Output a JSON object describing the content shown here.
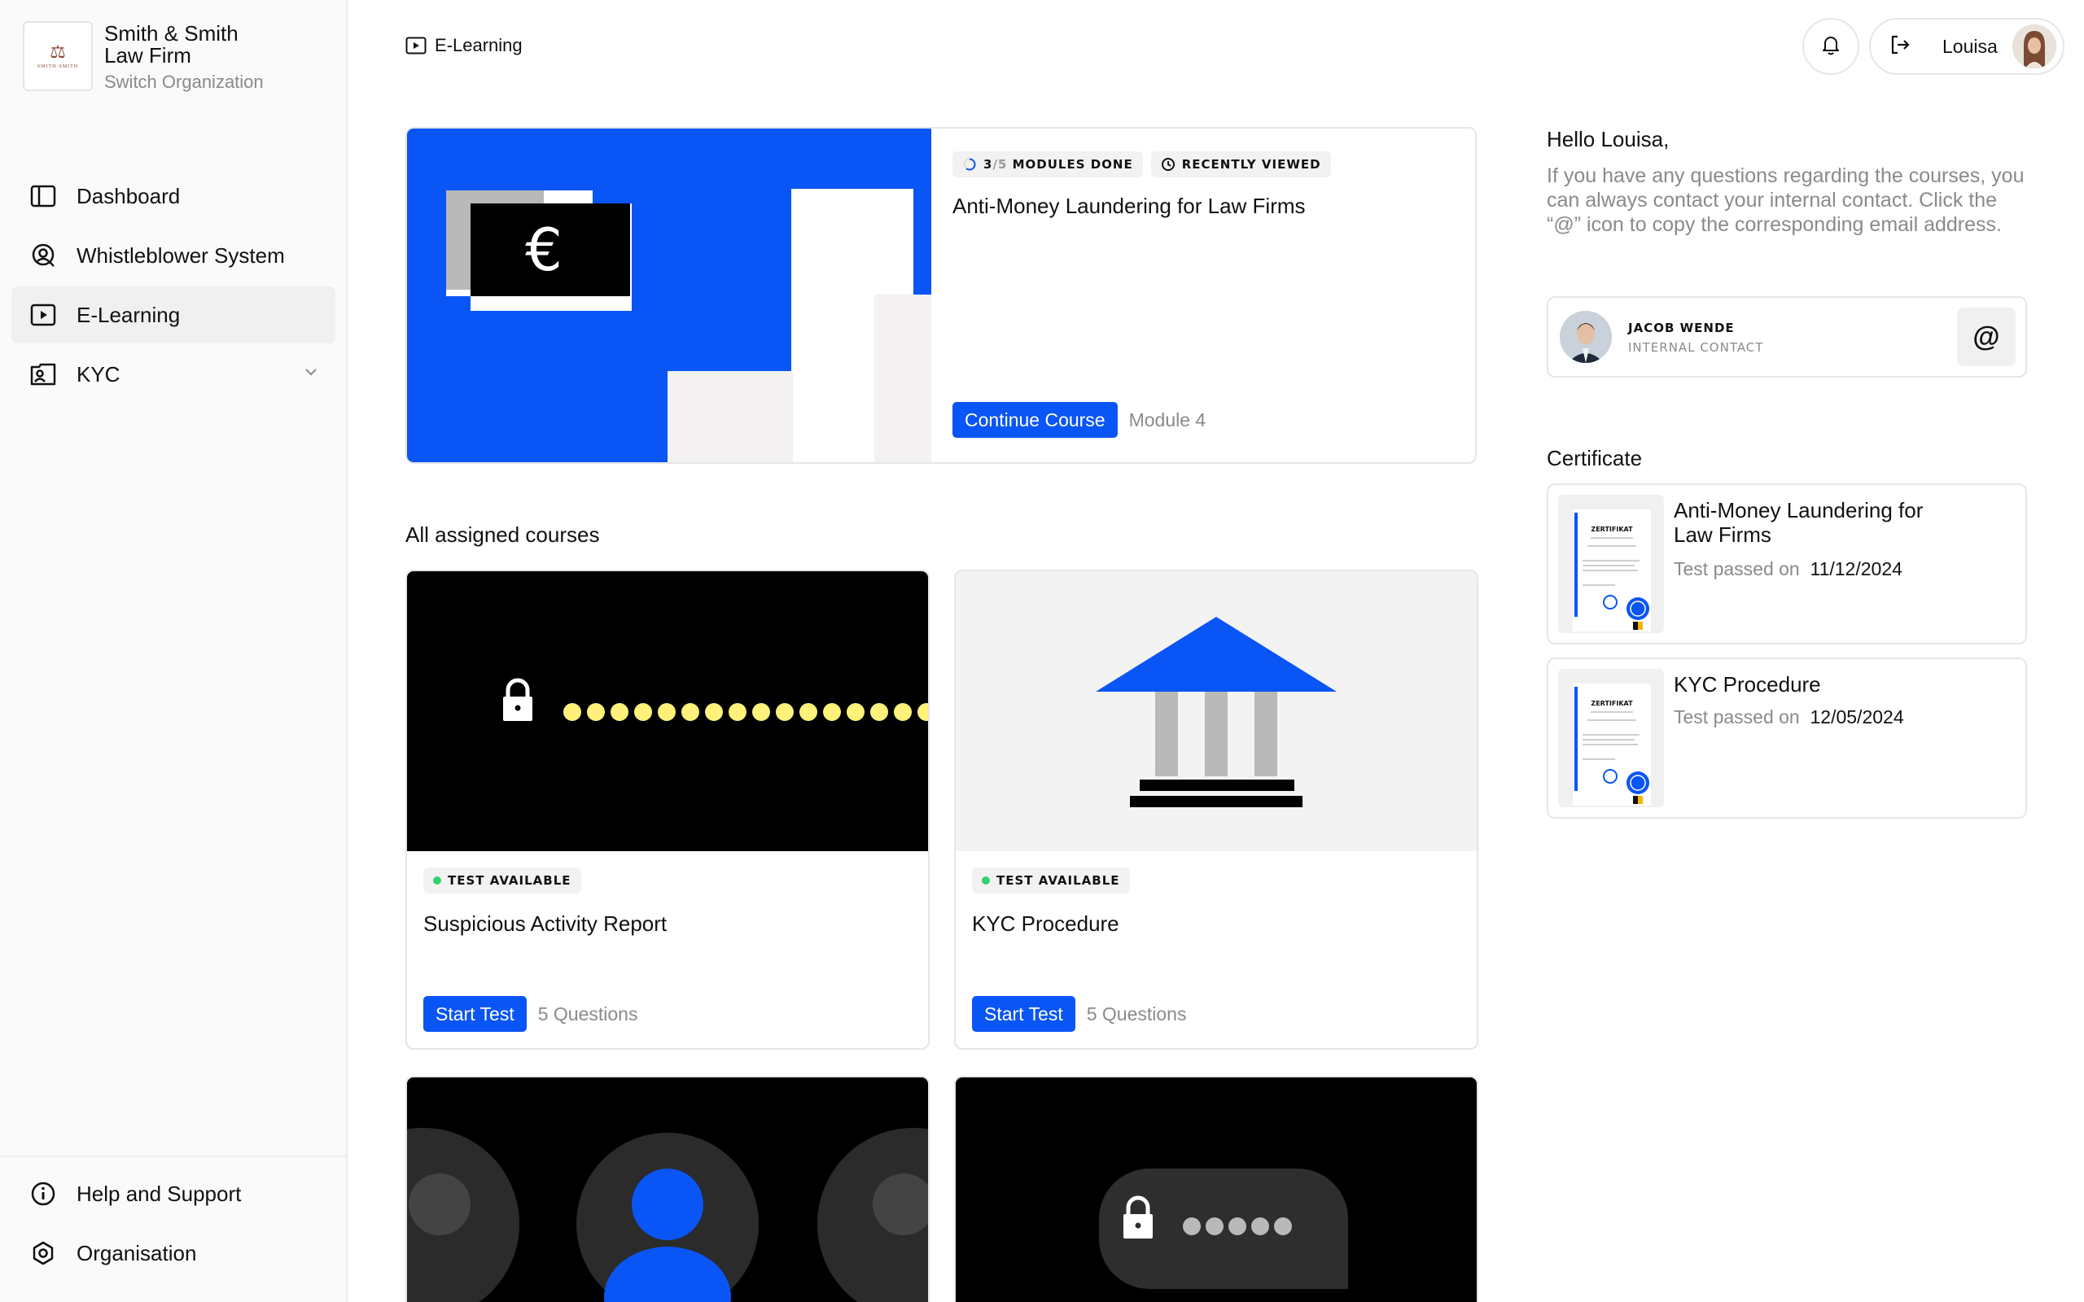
{
  "org": {
    "name": "Smith & Smith Law Firm",
    "switch_label": "Switch Organization",
    "logo_text": "SMITH·SMITH"
  },
  "nav": {
    "items": [
      {
        "label": "Dashboard",
        "icon": "sidebar-layout-icon"
      },
      {
        "label": "Whistleblower System",
        "icon": "whistleblower-icon"
      },
      {
        "label": "E-Learning",
        "icon": "play-square-icon",
        "active": true
      },
      {
        "label": "KYC",
        "icon": "id-card-icon",
        "expandable": true
      }
    ],
    "bottom": [
      {
        "label": "Help and Support",
        "icon": "info-icon"
      },
      {
        "label": "Organisation",
        "icon": "settings-hexagon-icon"
      }
    ]
  },
  "header": {
    "breadcrumb": "E-Learning",
    "user_name": "Louisa"
  },
  "hero": {
    "progress_done": "3",
    "progress_total": "/5",
    "progress_label": "MODULES DONE",
    "progress_fraction": 0.6,
    "recent_label": "RECENTLY VIEWED",
    "title": "Anti-Money Laundering for Law Firms",
    "button": "Continue Course",
    "meta": "Module 4",
    "image_symbol": "€"
  },
  "courses": {
    "section_title": "All assigned courses",
    "items": [
      {
        "badge": "TEST AVAILABLE",
        "title": "Suspicious Activity Report",
        "button": "Start Test",
        "meta": "5 Questions"
      },
      {
        "badge": "TEST AVAILABLE",
        "title": "KYC Procedure",
        "button": "Start Test",
        "meta": "5 Questions"
      }
    ]
  },
  "greeting": {
    "title": "Hello Louisa,",
    "text": "If you have any questions regarding the courses, you can always contact your internal contact. Click the “@” icon to copy the corresponding email address."
  },
  "contact": {
    "name": "JACOB WENDE",
    "role": "INTERNAL CONTACT",
    "action": "@"
  },
  "certificates": {
    "title": "Certificate",
    "items": [
      {
        "name": "Anti-Money Laundering for Law Firms",
        "passed_label": "Test passed on",
        "date": "11/12/2024",
        "thumb_text": "ZERTIFIKAT"
      },
      {
        "name": "KYC Procedure",
        "passed_label": "Test passed on",
        "date": "12/05/2024",
        "thumb_text": "ZERTIFIKAT"
      }
    ]
  },
  "colors": {
    "accent": "#0a55f5",
    "status_green": "#2fd36b",
    "muted": "#8a8a8a",
    "lock_dots": "#fff17a"
  }
}
